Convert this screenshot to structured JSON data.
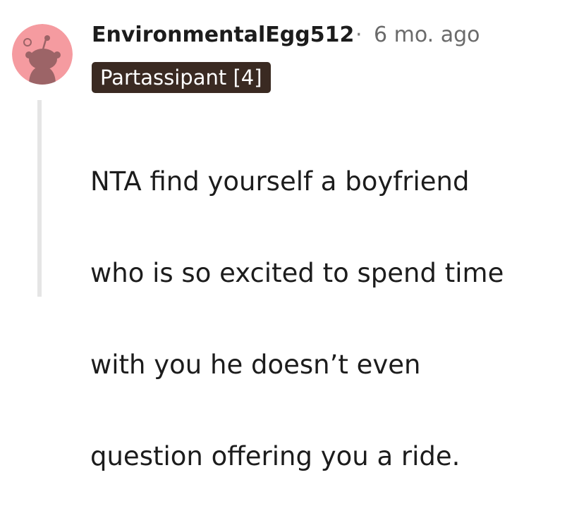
{
  "comment": {
    "username": "EnvironmentalEgg512",
    "separator": "·",
    "timestamp": "6 mo. ago",
    "flair": "Partassipant [4]",
    "avatar_icon": "snoo-avatar-icon",
    "body_lines": [
      "NTA find yourself a boyfriend",
      "who is so excited to spend time",
      "with you he doesn’t even",
      "question offering you a ride."
    ]
  },
  "colors": {
    "avatar_bg": "#f59ba0",
    "avatar_figure": "#9c6467",
    "flair_bg": "#3a2a22",
    "thread_line": "#e5e5e5"
  }
}
